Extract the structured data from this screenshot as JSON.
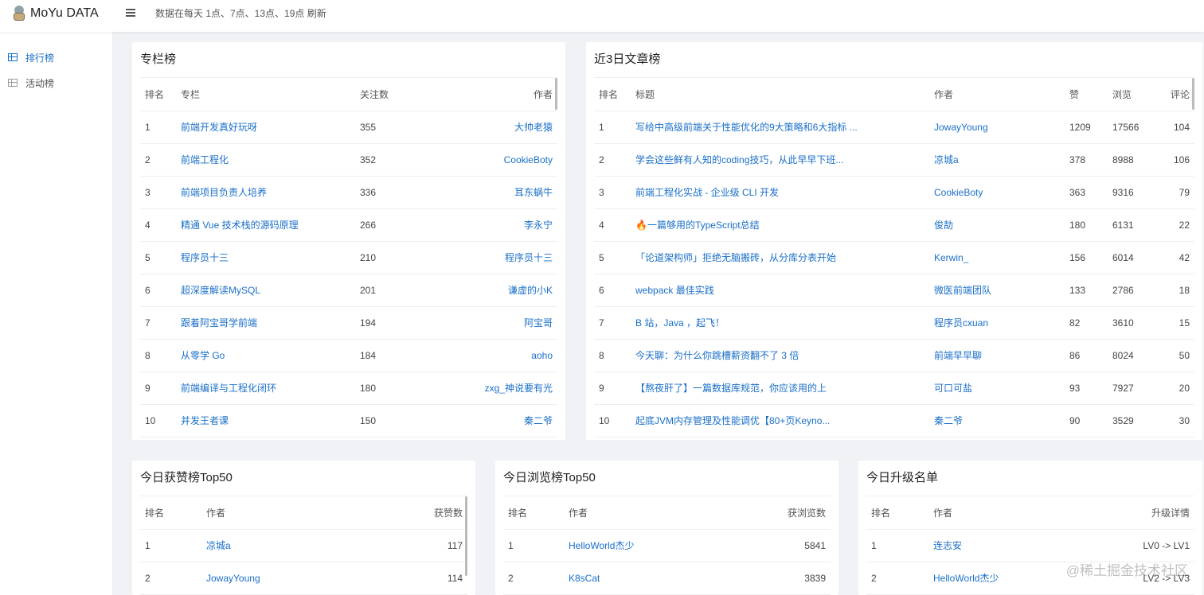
{
  "header": {
    "app_title": "MoYu DATA",
    "notice": "数据在每天 1点、7点、13点、19点 刷新"
  },
  "sidebar": {
    "items": [
      {
        "label": "排行榜"
      },
      {
        "label": "活动榜"
      }
    ]
  },
  "column_rank": {
    "title": "专栏榜",
    "headers": [
      "排名",
      "专栏",
      "关注数",
      "作者"
    ],
    "rows": [
      [
        "1",
        "前端开发真好玩呀",
        "355",
        "大帅老猿"
      ],
      [
        "2",
        "前端工程化",
        "352",
        "CookieBoty"
      ],
      [
        "3",
        "前端项目负责人培养",
        "336",
        "耳东蜗牛"
      ],
      [
        "4",
        "精通 Vue 技术栈的源码原理",
        "266",
        "李永宁"
      ],
      [
        "5",
        "程序员十三",
        "210",
        "程序员十三"
      ],
      [
        "6",
        "超深度解读MySQL",
        "201",
        "谦虚的小K"
      ],
      [
        "7",
        "跟着阿宝哥学前端",
        "194",
        "阿宝哥"
      ],
      [
        "8",
        "从零学 Go",
        "184",
        "aoho"
      ],
      [
        "9",
        "前端编译与工程化闭环",
        "180",
        "zxg_神说要有光"
      ],
      [
        "10",
        "并发王者课",
        "150",
        "秦二爷"
      ]
    ]
  },
  "article_rank": {
    "title": "近3日文章榜",
    "headers": [
      "排名",
      "标题",
      "作者",
      "赞",
      "浏览",
      "评论"
    ],
    "rows": [
      [
        "1",
        "写给中高级前端关于性能优化的9大策略和6大指标 ...",
        "JowayYoung",
        "1209",
        "17566",
        "104"
      ],
      [
        "2",
        "学会这些鲜有人知的coding技巧，从此早早下班...",
        "凉城a",
        "378",
        "8988",
        "106"
      ],
      [
        "3",
        "前端工程化实战 - 企业级 CLI 开发",
        "CookieBoty",
        "363",
        "9316",
        "79"
      ],
      [
        "4",
        "🔥一篇够用的TypeScript总结",
        "俊劼",
        "180",
        "6131",
        "22"
      ],
      [
        "5",
        "「论道架构师」拒绝无脑搬砖，从分库分表开始",
        "Kerwin_",
        "156",
        "6014",
        "42"
      ],
      [
        "6",
        "webpack 最佳实践",
        "微医前端团队",
        "133",
        "2786",
        "18"
      ],
      [
        "7",
        "B 站，Java ，起飞！",
        "程序员cxuan",
        "82",
        "3610",
        "15"
      ],
      [
        "8",
        "今天聊：为什么你跳槽薪资翻不了 3 倍",
        "前端早早聊",
        "86",
        "8024",
        "50"
      ],
      [
        "9",
        "【熬夜肝了】一篇数据库规范，你应该用的上",
        "可口可盐",
        "93",
        "7927",
        "20"
      ],
      [
        "10",
        "起底JVM内存管理及性能调优【80+页Keyno...",
        "秦二爷",
        "90",
        "3529",
        "30"
      ]
    ]
  },
  "likes_rank": {
    "title": "今日获赞榜Top50",
    "headers": [
      "排名",
      "作者",
      "获赞数"
    ],
    "rows": [
      [
        "1",
        "凉城a",
        "117"
      ],
      [
        "2",
        "JowayYoung",
        "114"
      ]
    ]
  },
  "views_rank": {
    "title": "今日浏览榜Top50",
    "headers": [
      "排名",
      "作者",
      "获浏览数"
    ],
    "rows": [
      [
        "1",
        "HelloWorld杰少",
        "5841"
      ],
      [
        "2",
        "K8sCat",
        "3839"
      ]
    ]
  },
  "upgrade_list": {
    "title": "今日升级名单",
    "headers": [
      "排名",
      "作者",
      "升级详情"
    ],
    "rows": [
      [
        "1",
        "连志安",
        "LV0 -> LV1"
      ],
      [
        "2",
        "HelloWorld杰少",
        "LV2 -> LV3"
      ]
    ]
  },
  "watermark": "@稀土掘金技术社区"
}
